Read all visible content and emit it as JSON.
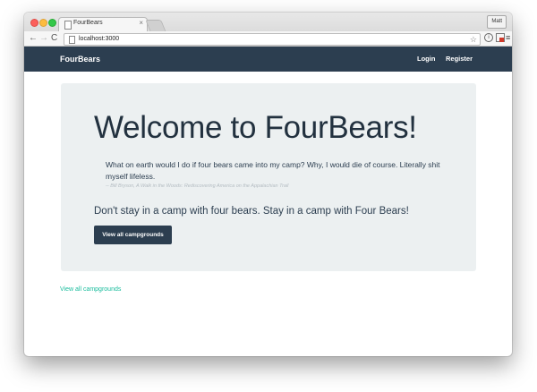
{
  "browser": {
    "tab_title": "FourBears",
    "tab_close": "×",
    "profile_name": "Matt",
    "url": "localhost:3000",
    "back_glyph": "←",
    "forward_glyph": "→",
    "reload_glyph": "C",
    "star_glyph": "☆",
    "info_glyph": "i",
    "menu_glyph": "≡"
  },
  "navbar": {
    "brand": "FourBears",
    "links": [
      {
        "label": "Login"
      },
      {
        "label": "Register"
      }
    ]
  },
  "jumbotron": {
    "title": "Welcome to FourBears!",
    "quote_text": "What on earth would I do if four bears came into my camp? Why, I would die of course. Literally shit myself lifeless.",
    "quote_cite": "-- Bill Bryson, A Walk in the Woods: Rediscovering America on the Appalachian Trail",
    "lead": "Don't stay in a camp with four bears. Stay in a camp with Four Bears!",
    "button_label": "View all campgrounds"
  },
  "footer_link": "View all campgrounds",
  "colors": {
    "navbar_bg": "#2c3e50",
    "jumbotron_bg": "#ecf0f1",
    "link": "#18bc9c",
    "button_bg": "#2c3e50"
  },
  "icons": [
    "page-icon",
    "star-icon",
    "info-icon",
    "extension-icon",
    "menu-icon"
  ]
}
